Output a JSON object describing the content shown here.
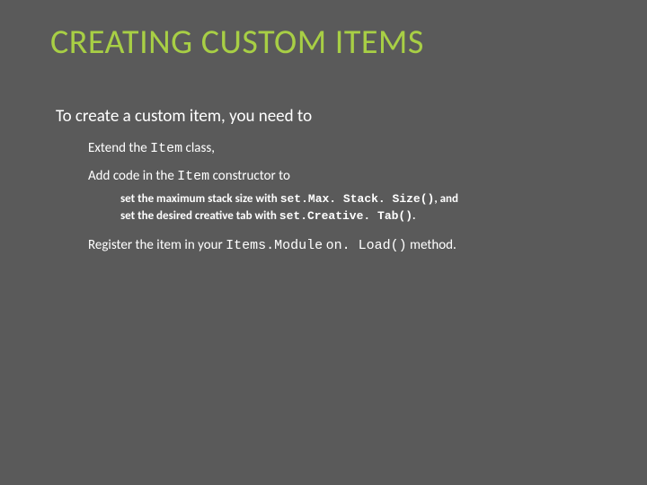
{
  "title": "CREATING CUSTOM ITEMS",
  "intro": "To create a custom item, you need to",
  "b1_pre": "Extend the ",
  "b1_code": "Item",
  "b1_post": " class,",
  "b2_pre": "Add code in the ",
  "b2_code": "Item",
  "b2_post": " constructor to",
  "sub1_pre": "set the maximum stack size with ",
  "sub1_code": "set.Max. Stack. Size()",
  "sub1_post": ", and",
  "sub2_pre": "set the desired creative tab with ",
  "sub2_code": "set.Creative. Tab()",
  "sub2_post": ".",
  "b3_pre": "Register the item in your ",
  "b3_code1": "Items.Module",
  "b3_mid": " ",
  "b3_code2": "on. Load()",
  "b3_post": " method."
}
